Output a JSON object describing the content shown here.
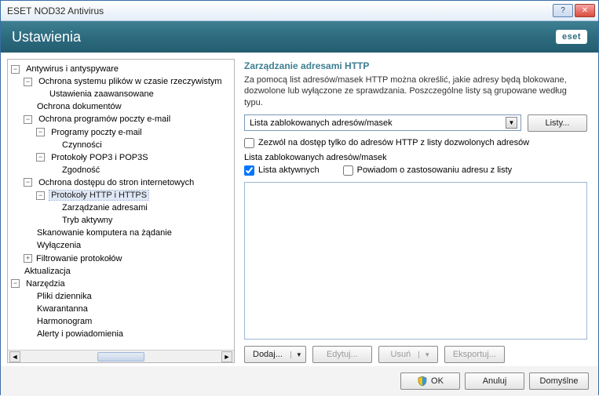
{
  "window": {
    "title": "ESET NOD32 Antivirus"
  },
  "brand": {
    "logo_text": "eset"
  },
  "header": {
    "title": "Ustawienia"
  },
  "tree": {
    "n0": "Antywirus i antyspyware",
    "n0_0": "Ochrona systemu plików w czasie rzeczywistym",
    "n0_0_0": "Ustawienia zaawansowane",
    "n0_1": "Ochrona dokumentów",
    "n0_2": "Ochrona programów poczty e-mail",
    "n0_2_0": "Programy poczty e-mail",
    "n0_2_0_0": "Czynności",
    "n0_2_1": "Protokoły POP3 i POP3S",
    "n0_2_1_0": "Zgodność",
    "n0_3": "Ochrona dostępu do stron internetowych",
    "n0_3_0": "Protokoły HTTP i HTTPS",
    "n0_3_0_0": "Zarządzanie adresami",
    "n0_3_0_1": "Tryb aktywny",
    "n0_4": "Skanowanie komputera na żądanie",
    "n0_5": "Wyłączenia",
    "n0_6": "Filtrowanie protokołów",
    "n1": "Aktualizacja",
    "n2": "Narzędzia",
    "n2_0": "Pliki dziennika",
    "n2_1": "Kwarantanna",
    "n2_2": "Harmonogram",
    "n2_3": "Alerty i powiadomienia"
  },
  "right": {
    "heading": "Zarządzanie adresami HTTP",
    "description": "Za pomocą list adresów/masek HTTP można określić, jakie adresy będą blokowane, dozwolone lub wyłączone ze sprawdzania. Poszczególne listy są grupowane według typu.",
    "combo_value": "Lista zablokowanych adresów/masek",
    "lists_btn": "Listy...",
    "allow_only_label": "Zezwól na dostęp tylko do adresów HTTP z listy dozwolonych adresów",
    "group_label": "Lista zablokowanych adresów/masek",
    "active_list_label": "Lista aktywnych",
    "notify_label": "Powiadom o zastosowaniu adresu z listy",
    "add_btn": "Dodaj...",
    "edit_btn": "Edytuj...",
    "delete_btn": "Usuń",
    "export_btn": "Eksportuj..."
  },
  "footer": {
    "ok": "OK",
    "cancel": "Anuluj",
    "default": "Domyślne"
  },
  "glyphs": {
    "minus": "−",
    "plus": "+",
    "down": "▼",
    "left": "◄",
    "right": "►",
    "help": "?",
    "close": "✕"
  }
}
